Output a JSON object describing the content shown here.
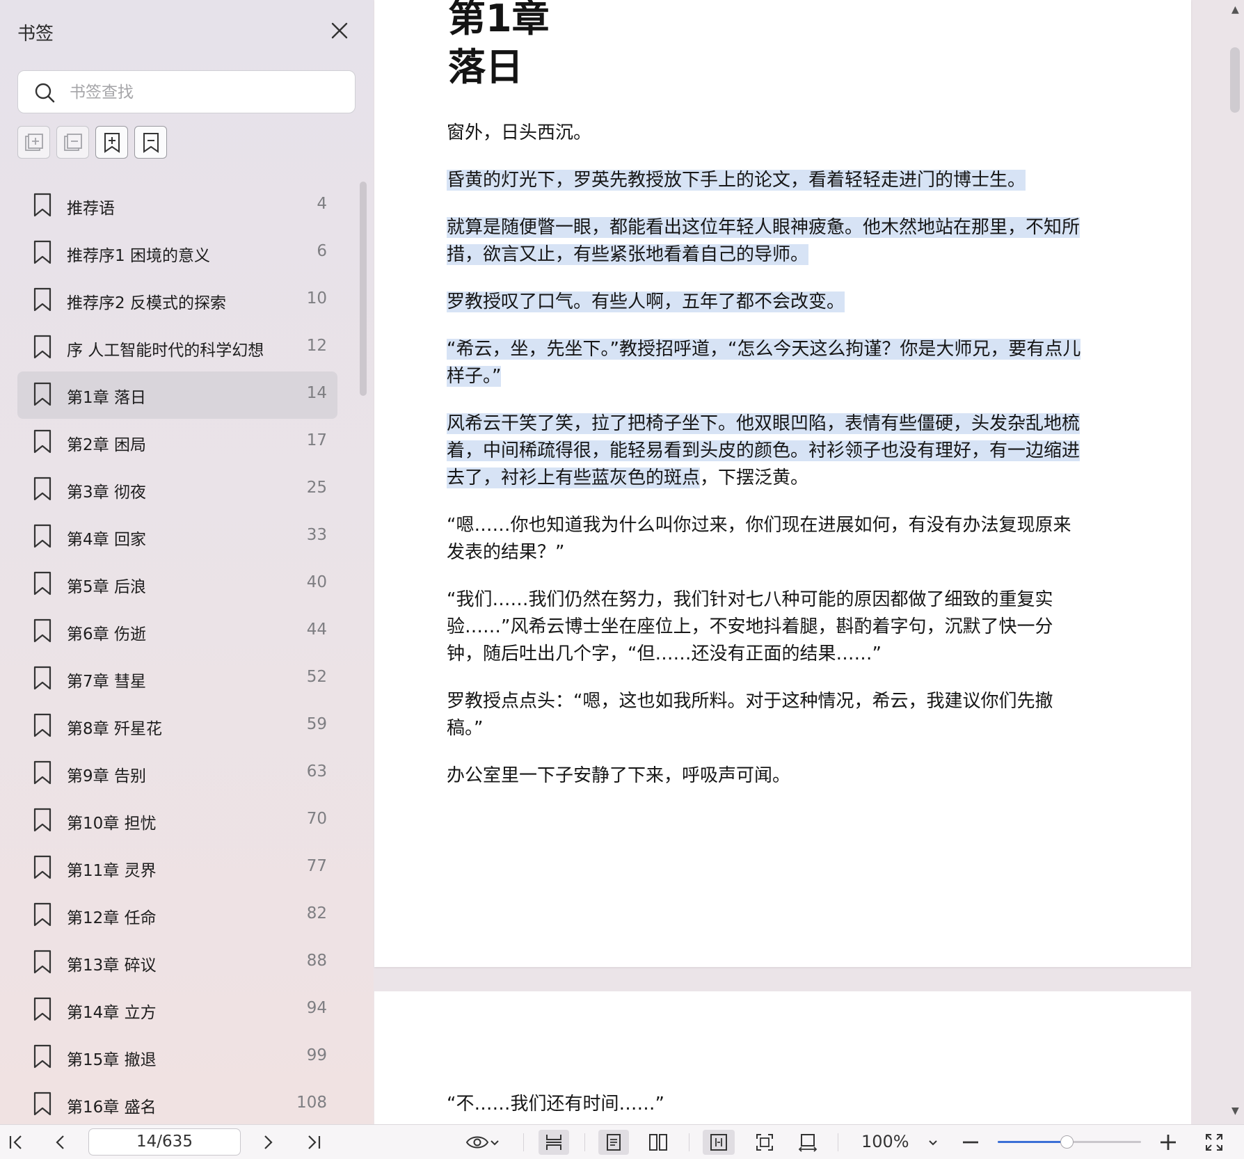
{
  "sidebar": {
    "title": "书签",
    "search_placeholder": "书签查找",
    "items": [
      {
        "label": "推荐语",
        "page": "4"
      },
      {
        "label": "推荐序1 困境的意义",
        "page": "6"
      },
      {
        "label": "推荐序2 反模式的探索",
        "page": "10"
      },
      {
        "label": "序 人工智能时代的科学幻想",
        "page": "12"
      },
      {
        "label": "第1章 落日",
        "page": "14",
        "selected": true
      },
      {
        "label": "第2章 困局",
        "page": "17"
      },
      {
        "label": "第3章 彻夜",
        "page": "25"
      },
      {
        "label": "第4章 回家",
        "page": "33"
      },
      {
        "label": "第5章 后浪",
        "page": "40"
      },
      {
        "label": "第6章 伤逝",
        "page": "44"
      },
      {
        "label": "第7章 彗星",
        "page": "52"
      },
      {
        "label": "第8章 歼星花",
        "page": "59"
      },
      {
        "label": "第9章 告别",
        "page": "63"
      },
      {
        "label": "第10章 担忧",
        "page": "70"
      },
      {
        "label": "第11章 灵界",
        "page": "77"
      },
      {
        "label": "第12章 任命",
        "page": "82"
      },
      {
        "label": "第13章 碎议",
        "page": "88"
      },
      {
        "label": "第14章 立方",
        "page": "94"
      },
      {
        "label": "第15章 撤退",
        "page": "99"
      },
      {
        "label": "第16章 盛名",
        "page": "108"
      }
    ]
  },
  "document": {
    "chapter_number": "第1章",
    "chapter_title": "落日",
    "paragraphs": [
      {
        "parts": [
          {
            "text": "窗外，日头西沉。",
            "hl": false
          }
        ]
      },
      {
        "parts": [
          {
            "text": "昏黄的灯光下，罗英先教授放下手上的论文，看着轻轻走进门的博士生。",
            "hl": true
          }
        ]
      },
      {
        "parts": [
          {
            "text": "就算是随便瞥一眼，都能看出这位年轻人眼神疲惫。他木然地站在那里，不知所措，欲言又止，有些紧张地看着自己的导师。",
            "hl": true
          }
        ]
      },
      {
        "parts": [
          {
            "text": "罗教授叹了口气。有些人啊，五年了都不会改变。",
            "hl": true
          }
        ]
      },
      {
        "parts": [
          {
            "text": "“希云，坐，先坐下。”教授招呼道，“怎么今天这么拘谨？你是大师兄，要有点儿样子。”",
            "hl": true
          }
        ]
      },
      {
        "parts": [
          {
            "text": "风希云干笑了笑，拉了把椅子坐下。他双眼凹陷，表情有些僵硬，头发杂乱地梳着，中间稀疏得很，能轻易看到头皮的颜色。衬衫领子也没有理好，有一边缩进去了，衬衫上有些蓝灰色的斑点",
            "hl": true
          },
          {
            "text": "，下摆泛黄。",
            "hl": false
          }
        ]
      },
      {
        "parts": [
          {
            "text": "“嗯……你也知道我为什么叫你过来，你们现在进展如何，有没有办法复现原来发表的结果？”",
            "hl": false
          }
        ]
      },
      {
        "parts": [
          {
            "text": "“我们……我们仍然在努力，我们针对七八种可能的原因都做了细致的重复实验……”风希云博士坐在座位上，不安地抖着腿，斟酌着字句，沉默了快一分钟，随后吐出几个字，“但……还没有正面的结果……”",
            "hl": false
          }
        ]
      },
      {
        "parts": [
          {
            "text": "罗教授点点头：“嗯，这也如我所料。对于这种情况，希云，我建议你们先撤稿。”",
            "hl": false
          }
        ]
      },
      {
        "parts": [
          {
            "text": "办公室里一下子安静了下来，呼吸声可闻。",
            "hl": false
          }
        ]
      }
    ],
    "next_page_text": "“不……我们还有时间……”"
  },
  "toolbar": {
    "page_indicator": "14/635",
    "zoom_level": "100%",
    "zoom_fraction": 0.48,
    "icons": [
      "first-page-icon",
      "prev-page-icon",
      "next-page-icon",
      "last-page-icon",
      "eye-icon",
      "continuous-scroll-icon",
      "single-page-icon",
      "two-page-icon",
      "fit-width-icon",
      "fit-page-icon",
      "rotate-icon",
      "zoom-out-icon",
      "zoom-in-icon",
      "fullscreen-icon"
    ]
  },
  "colors": {
    "highlight": "#d7e3f5",
    "accent": "#3b6fd6",
    "selected_row": "#d9d5db"
  }
}
